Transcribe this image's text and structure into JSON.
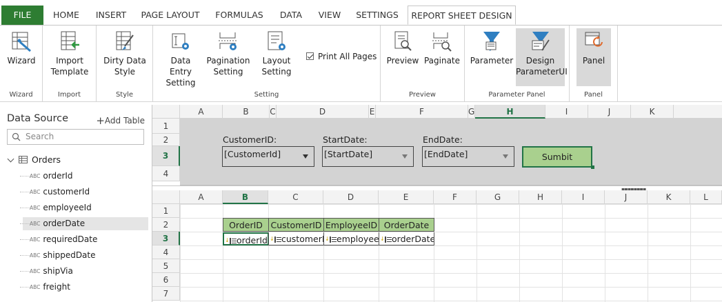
{
  "tabs": {
    "file": "FILE",
    "home": "HOME",
    "insert": "INSERT",
    "page_layout": "PAGE LAYOUT",
    "formulas": "FORMULAS",
    "data": "DATA",
    "view": "VIEW",
    "settings": "SETTINGS",
    "report": "REPORT SHEET DESIGN"
  },
  "ribbon": {
    "groups": {
      "wizard": "Wizard",
      "import": "Import",
      "style": "Style",
      "setting": "Setting",
      "preview": "Preview",
      "parameter_panel": "Parameter Panel",
      "panel": "Panel"
    },
    "wizard": "Wizard",
    "import_template": "Import Template",
    "dirty_data_style": "Dirty Data Style",
    "data_entry_setting": "Data Entry Setting",
    "pagination_setting": "Pagination Setting",
    "layout_setting": "Layout Setting",
    "print_all_pages": "Print All Pages",
    "preview": "Preview",
    "paginate": "Paginate",
    "parameter": "Parameter",
    "design_parameter_ui": "Design ParameterUI",
    "panel": "Panel"
  },
  "datasource": {
    "title": "Data Source",
    "add_table": "Add Table",
    "search_placeholder": "Search",
    "table": "Orders",
    "field_type": "ABC",
    "fields": [
      "orderId",
      "customerId",
      "employeeId",
      "orderDate",
      "requiredDate",
      "shippedDate",
      "shipVia",
      "freight"
    ]
  },
  "param_sheet": {
    "columns": [
      "A",
      "B",
      "C",
      "D",
      "E",
      "F",
      "G",
      "H",
      "I",
      "J",
      "K"
    ],
    "rows": [
      "1",
      "2",
      "3",
      "4"
    ],
    "labels": {
      "customer": "CustomerID:",
      "start": "StartDate:",
      "end": "EndDate:"
    },
    "combos": {
      "customer": "[CustomerId]",
      "start": "[StartDate]",
      "end": "[EndDate]"
    },
    "submit": "Sumbit"
  },
  "report_sheet": {
    "columns": [
      "A",
      "B",
      "C",
      "D",
      "E",
      "F",
      "G",
      "H",
      "I",
      "J",
      "K",
      "L"
    ],
    "rows": [
      "1",
      "2",
      "3",
      "4",
      "5",
      "6",
      "7"
    ],
    "headers": [
      "OrderID",
      "CustomerID",
      "EmployeeID",
      "OrderDate"
    ],
    "fields": [
      "orderId",
      "customerId",
      "employeeId",
      "orderDate"
    ]
  },
  "colors": {
    "accent": "#217346",
    "file_tab": "#2e7d32",
    "header_fill": "#a9d08e",
    "param_bg": "#d3d3d3"
  }
}
